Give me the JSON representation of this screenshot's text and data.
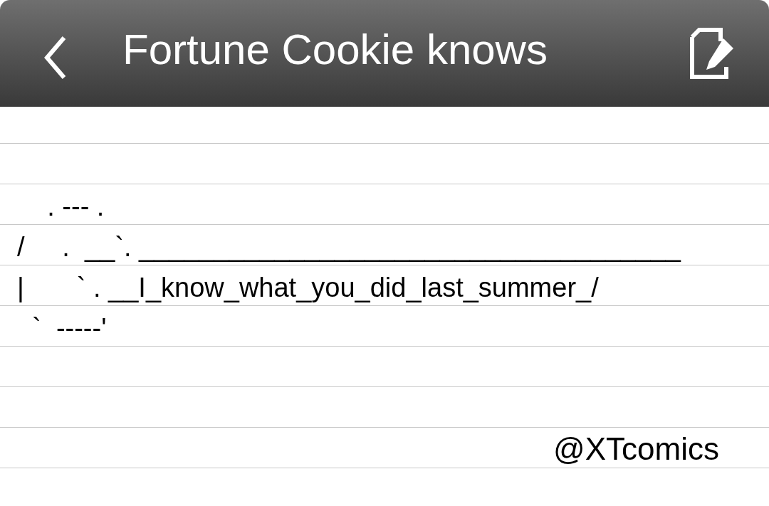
{
  "header": {
    "title": "Fortune Cookie knows"
  },
  "note": {
    "lines": [
      "    . --- .",
      "/     .  __`. ____________________________________",
      "|       ` . __I_know_what_you_did_last_summer_/",
      "  `  -----'"
    ],
    "signature": "@XTcomics"
  }
}
